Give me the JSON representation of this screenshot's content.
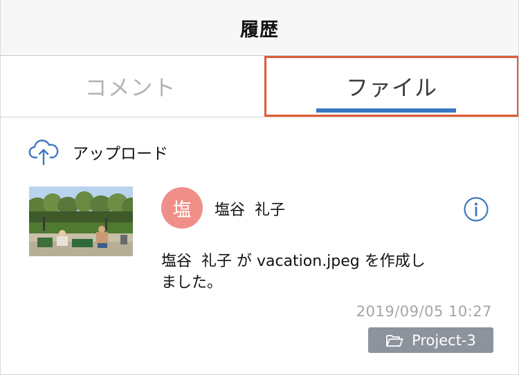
{
  "header": {
    "title": "履歴"
  },
  "tabs": [
    {
      "label": "コメント",
      "selected": false
    },
    {
      "label": "ファイル",
      "selected": true
    }
  ],
  "upload": {
    "icon": "cloud-upload-icon",
    "label": "アップロード"
  },
  "activity": {
    "thumbnail_icon": "photo-thumbnail",
    "avatar_char": "塩",
    "avatar_color": "#ef8f88",
    "user_name": "塩谷  礼子",
    "info_icon": "info-circle-icon",
    "message": "塩谷  礼子 が vacation.jpeg を作成し\nました。",
    "timestamp": "2019/09/05 10:27",
    "project": {
      "icon": "folder-open-icon",
      "label": "Project-3"
    }
  },
  "colors": {
    "accent_blue": "#3b78c4",
    "highlight_red": "#e05a35",
    "badge_gray": "#8d939c",
    "timestamp_gray": "#a5a5a5"
  }
}
